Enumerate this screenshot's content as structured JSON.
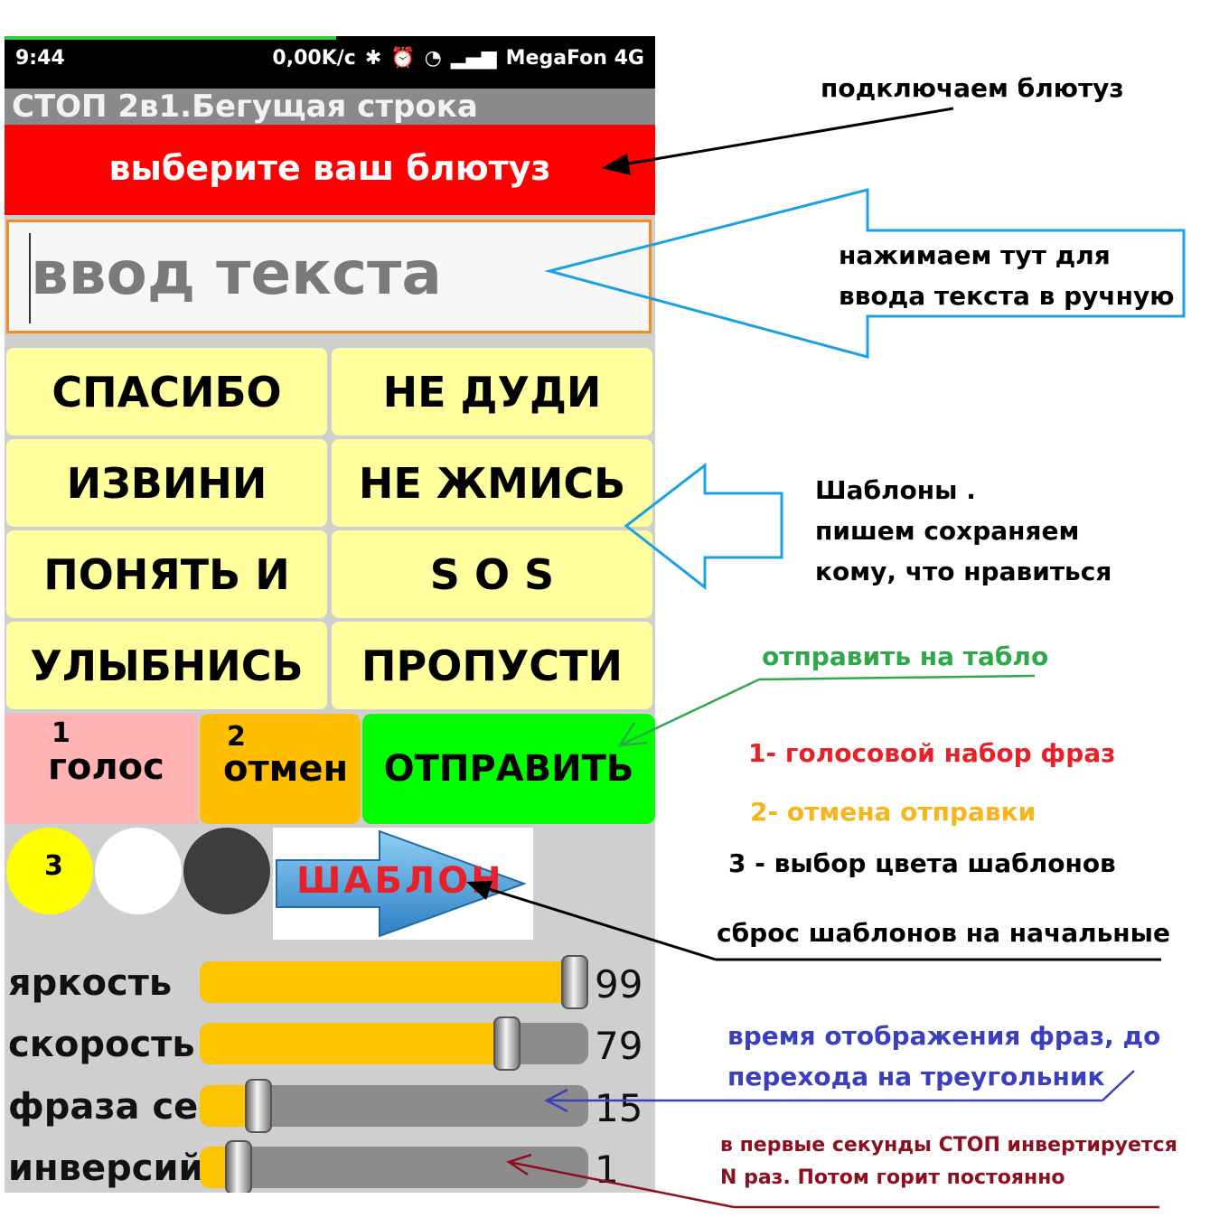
{
  "status_bar": {
    "time": "9:44",
    "speed": "0,00K/c",
    "carrier": "MegaFon 4G"
  },
  "app_title": "СТОП 2в1.Бегущая строка",
  "bluetooth_button": "выберите ваш блютуз",
  "text_input": {
    "placeholder": "ввод текста"
  },
  "templates": [
    {
      "label": "СПАСИБО"
    },
    {
      "label": "НЕ ДУДИ"
    },
    {
      "label": "ИЗВИНИ"
    },
    {
      "label": "НЕ ЖМИСЬ"
    },
    {
      "label": "ПОНЯТЬ И"
    },
    {
      "label": "S O S"
    },
    {
      "label": "УЛЫБНИСЬ"
    },
    {
      "label": "ПРОПУСТИ"
    }
  ],
  "controls": {
    "voice": {
      "number": "1",
      "label": "голос"
    },
    "cancel": {
      "number": "2",
      "label": "отмен"
    },
    "send": {
      "label": "ОТПРАВИТЬ"
    }
  },
  "color_circles": [
    {
      "number": "3",
      "color": "#ffff00"
    },
    {
      "number": "",
      "color": "#ffffff"
    },
    {
      "number": "",
      "color": "#3d3d3d"
    }
  ],
  "reset_button": {
    "label": "ШАБЛОН"
  },
  "sliders": [
    {
      "label": "яркость",
      "value": "99",
      "level": 0.99
    },
    {
      "label": "скорость",
      "value": "79",
      "level": 0.79
    },
    {
      "label": "фраза сек",
      "value": "15",
      "level": 0.15
    },
    {
      "label": "инверсий",
      "value": "1",
      "level": 0.1
    }
  ],
  "annotations": {
    "bluetooth": "подключаем блютуз",
    "input_line1": "нажимаем тут для",
    "input_line2": "ввода текста в ручную",
    "templates_line1": "Шаблоны .",
    "templates_line2": "пишем сохраняем",
    "templates_line3": "кому, что нравиться",
    "send": "отправить на табло",
    "legend1": "1- голосовой набор фраз",
    "legend2": "2- отмена отправки",
    "legend3": "3 - выбор цвета шаблонов",
    "reset": "сброс шаблонов на начальные",
    "phrase_line1": "время отображения фраз, до",
    "phrase_line2": "перехода на треугольник",
    "inversion_line1": "в первые секунды СТОП инвертируется",
    "inversion_line2": "N раз. Потом горит постоянно"
  },
  "colors": {
    "bluetooth_bg": "#ff0000",
    "template_bg": "#ffff9e",
    "voice_bg": "#ffb3b3",
    "cancel_bg": "#ffbf00",
    "send_bg": "#00ff00",
    "slider_fill": "#ffc400",
    "note_green": "#2ea84a",
    "note_red": "#e8202a",
    "note_orange": "#f7b51c",
    "note_blue": "#3a3fbf",
    "note_darkred": "#8b0f1f"
  }
}
